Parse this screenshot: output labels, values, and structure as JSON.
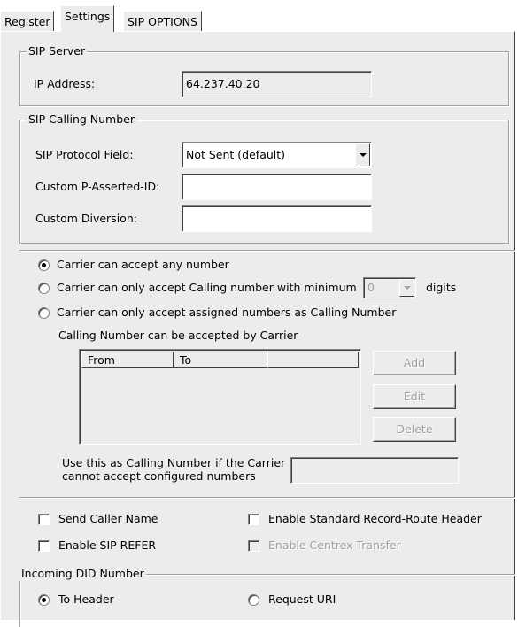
{
  "tabs": [
    {
      "label": "Register",
      "active": false
    },
    {
      "label": "Settings",
      "active": true
    },
    {
      "label": "SIP OPTIONS",
      "active": false
    }
  ],
  "sip_server": {
    "legend": "SIP Server",
    "ip_label": "IP Address:",
    "ip_value": "64.237.40.20"
  },
  "sip_calling_number": {
    "legend": "SIP Calling Number",
    "protocol_field_label": "SIP Protocol Field:",
    "protocol_field_value": "Not Sent (default)",
    "custom_pai_label": "Custom P-Asserted-ID:",
    "custom_pai_value": "",
    "custom_diversion_label": "Custom Diversion:",
    "custom_diversion_value": ""
  },
  "carrier_options": {
    "radio_any": "Carrier can accept any number",
    "radio_min": "Carrier can only accept Calling number with minimum",
    "min_digits_value": "0",
    "digits_label": "digits",
    "radio_assigned": "Carrier can only accept assigned numbers as Calling Number",
    "selected": "any",
    "accepted_label": "Calling Number can be accepted by Carrier",
    "columns": [
      "From",
      "To"
    ],
    "rows": [],
    "add_label": "Add",
    "edit_label": "Edit",
    "delete_label": "Delete",
    "fallback_label_line1": "Use this as Calling Number if the Carrier",
    "fallback_label_line2": "cannot accept configured numbers",
    "fallback_value": ""
  },
  "options": {
    "send_caller_name": "Send Caller Name",
    "enable_sip_refer": "Enable SIP REFER",
    "enable_record_route": "Enable Standard Record-Route Header",
    "enable_centrex_transfer": "Enable Centrex Transfer"
  },
  "incoming_did": {
    "legend": "Incoming DID Number",
    "to_header": "To Header",
    "request_uri": "Request URI",
    "selected": "to_header"
  }
}
